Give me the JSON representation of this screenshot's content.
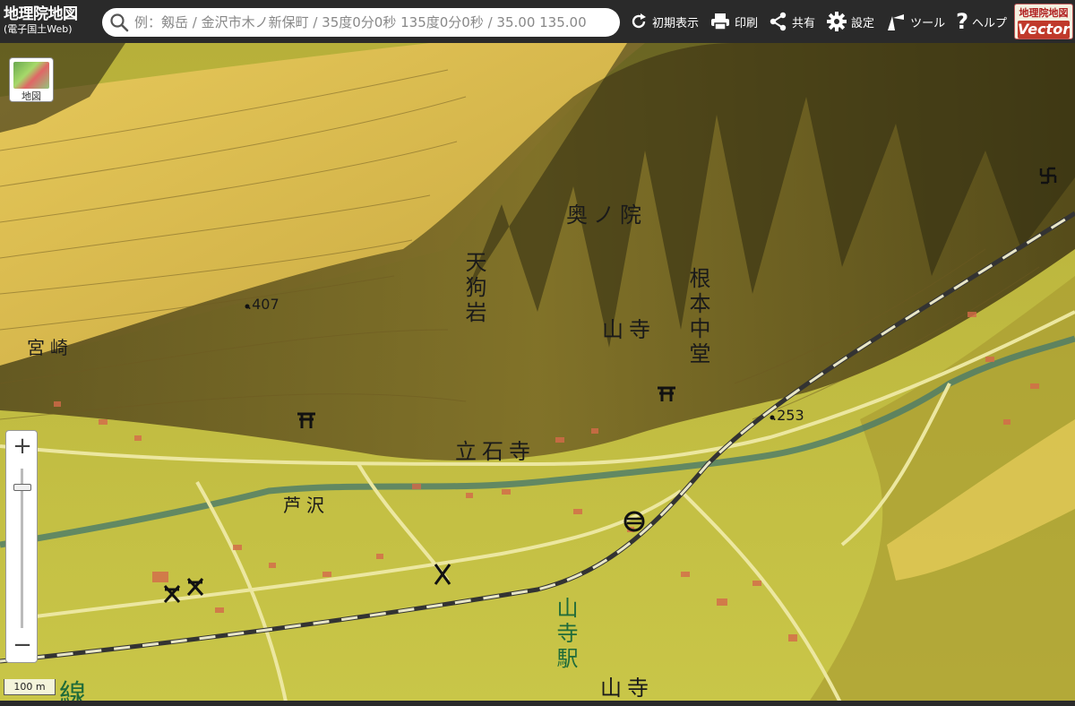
{
  "header": {
    "title": "地理院地図",
    "subtitle": "(電子国土Web)",
    "search_placeholder": "例：剱岳 / 金沢市木ノ新保町 / 35度0分0秒 135度0分0秒 / 35.00 135.00",
    "tools": [
      {
        "label": "初期表示",
        "icon": "reload-icon"
      },
      {
        "label": "印刷",
        "icon": "printer-icon"
      },
      {
        "label": "共有",
        "icon": "share-icon"
      },
      {
        "label": "設定",
        "icon": "gear-icon"
      },
      {
        "label": "ツール",
        "icon": "tool-icon"
      },
      {
        "label": "ヘルプ",
        "icon": "help-icon"
      }
    ],
    "vector_logo": {
      "top": "地理院地図",
      "bottom": "Vector"
    }
  },
  "map_switch": {
    "label": "地図"
  },
  "zoom": {
    "plus": "+",
    "minus": "−",
    "level_fraction": 0.1
  },
  "scale": {
    "label": "100 m"
  },
  "map_labels": {
    "okunoin": "奥ノ院",
    "tenguiwa": "天狗岩",
    "yamadera_temple": "山寺",
    "konponchudo": "根本中堂",
    "miyazaki": "宮崎",
    "elev_407": ".407",
    "elev_253": ".253",
    "risshakuji": "立石寺",
    "ashizawa": "芦沢",
    "yamadera_station": "山寺駅",
    "yamadera_town": "山寺",
    "line": "線"
  },
  "colors": {
    "header_bg": "#2a2a2a",
    "terrain_low": "#c8c23a",
    "terrain_mid": "#a69a2a",
    "terrain_dark": "#3b3512",
    "terrain_light": "#e8d060",
    "river": "#4a7a6a",
    "building": "#d46a4a",
    "station_text": "#1f6b3a"
  }
}
